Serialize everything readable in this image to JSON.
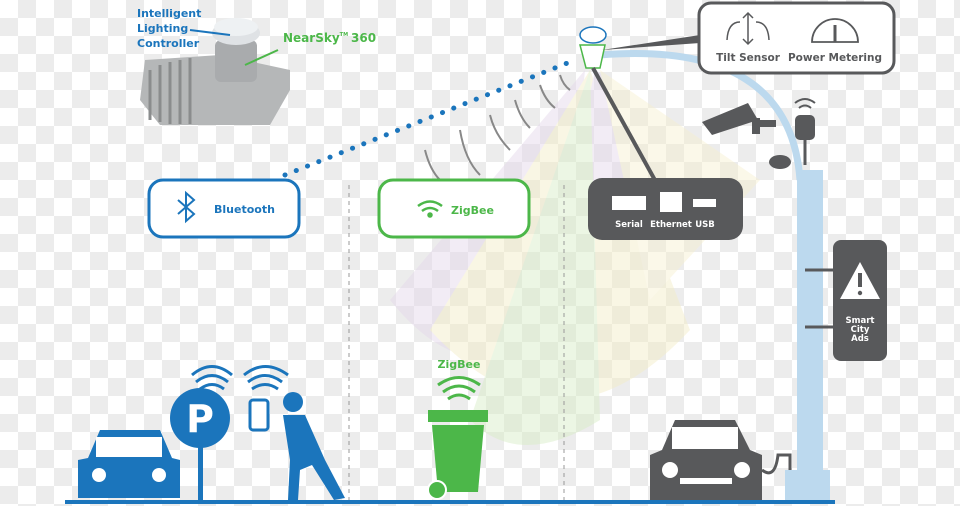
{
  "device": {
    "controller_label": [
      "Intelligent",
      "Lighting",
      "Controller"
    ],
    "product_name": "NearSky",
    "product_tm": "TM",
    "product_model": "360"
  },
  "sensors": {
    "tilt": "Tilt Sensor",
    "power": "Power Metering"
  },
  "protocols": {
    "bluetooth": "Bluetooth",
    "zigbee": "ZigBee",
    "bin_zigbee": "ZigBee"
  },
  "ports": {
    "serial": "Serial",
    "ethernet": "Ethernet",
    "usb": "USB"
  },
  "ads_panel": {
    "lines": [
      "Smart",
      "City",
      "Ads"
    ]
  },
  "parking_sign": "P",
  "colors": {
    "blue": "#1b75bc",
    "green": "#4cb749",
    "gray": "#58595b",
    "pole": "#bcd9ee"
  }
}
